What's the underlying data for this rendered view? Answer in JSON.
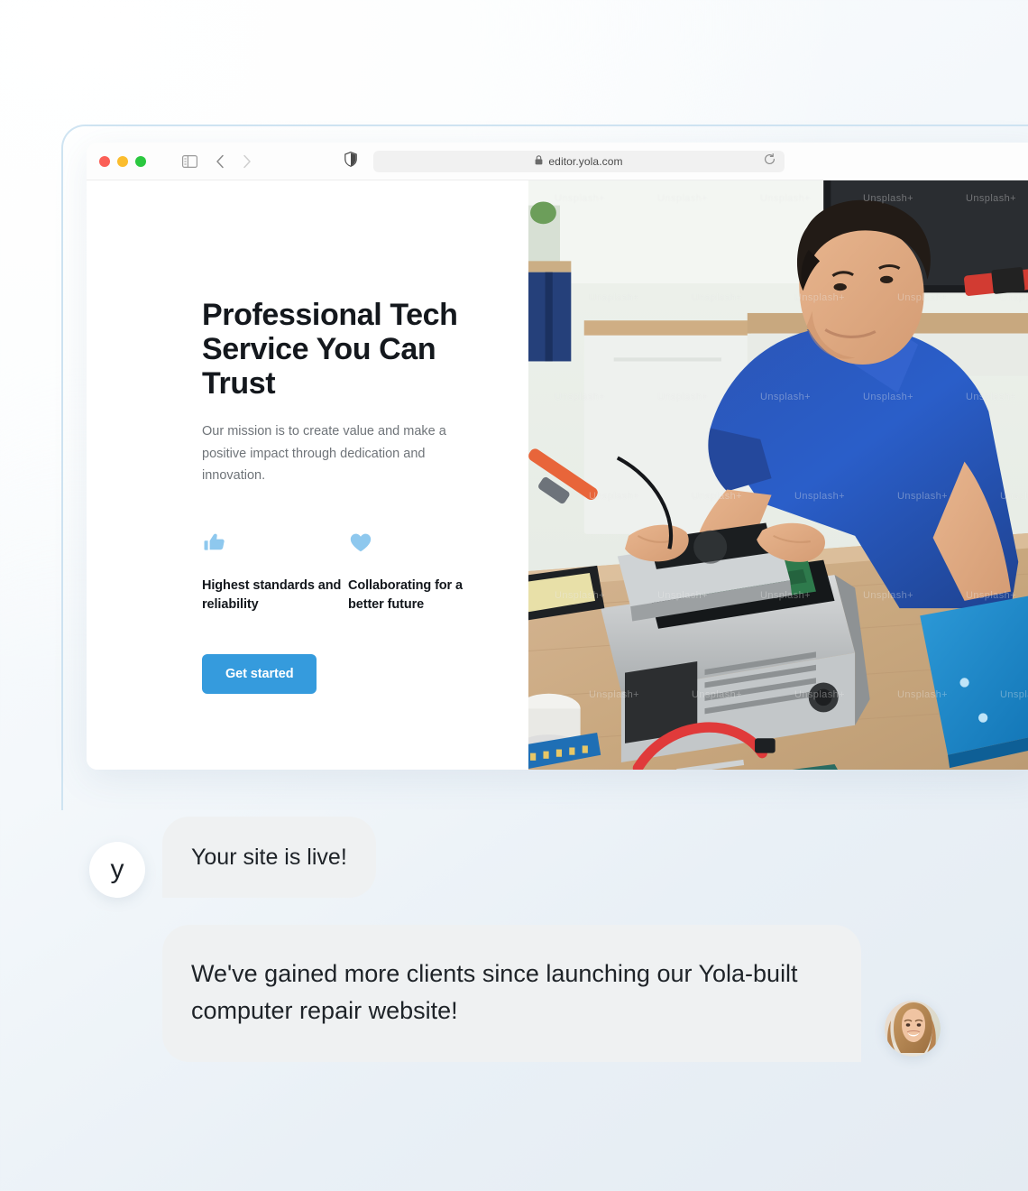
{
  "browser": {
    "traffic_lights": [
      "close",
      "minimize",
      "maximize"
    ],
    "sidebar_icon": "sidebar-toggle-icon",
    "back_icon": "chevron-left-icon",
    "forward_icon": "chevron-right-icon",
    "shield_icon": "privacy-shield-icon",
    "lock_icon": "lock-icon",
    "url": "editor.yola.com",
    "reload_icon": "reload-icon"
  },
  "site": {
    "headline": "Professional Tech Service You Can Trust",
    "subtext": "Our mission is to create value and make a positive impact through dedication and innovation.",
    "features": [
      {
        "icon": "thumbs-up-icon",
        "label": "Highest standards and reliability"
      },
      {
        "icon": "heart-icon",
        "label": "Collaborating for a better future"
      }
    ],
    "cta_label": "Get started",
    "photo_alt": "technician repairing a desktop computer",
    "photo_watermark": "Unsplash+"
  },
  "chat": {
    "brand_avatar_letter": "y",
    "messages": [
      {
        "from": "yola",
        "text": "Your site is live!"
      },
      {
        "from": "customer",
        "text": "We've gained more clients since launching our Yola-built computer repair website!"
      }
    ]
  },
  "colors": {
    "accent_blue": "#359bdd",
    "feature_icon_blue": "#8ec8ee",
    "bubble_grey": "#eff1f2",
    "frame_blue": "#cfe4f2"
  }
}
